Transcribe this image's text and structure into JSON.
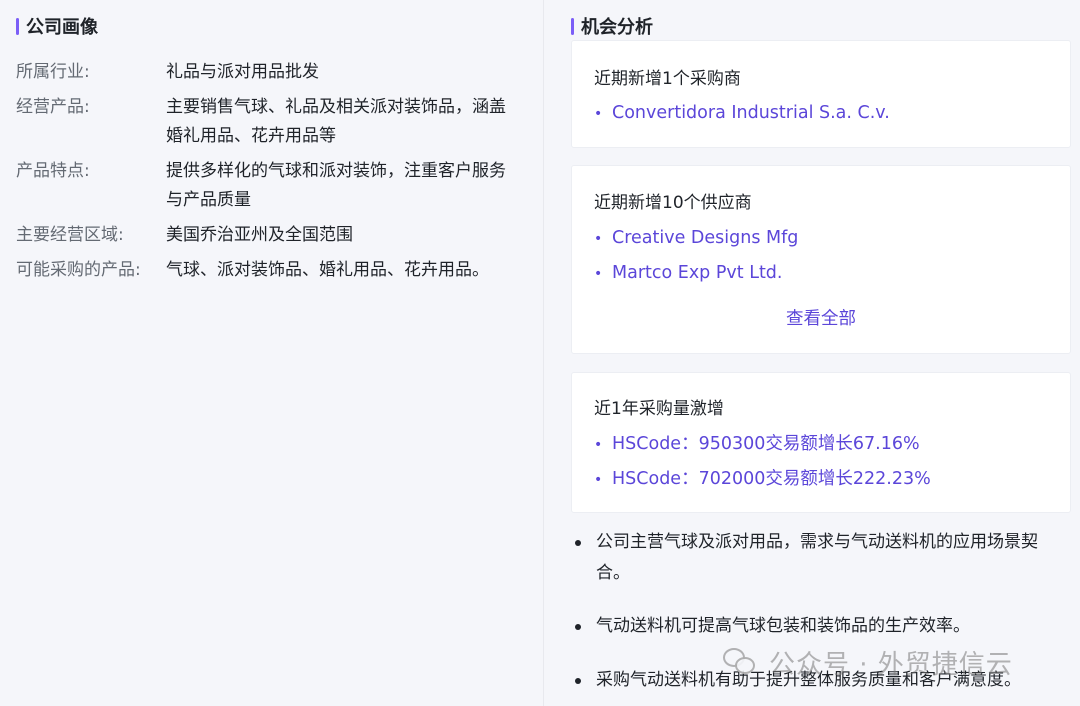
{
  "company_profile": {
    "title": "公司画像",
    "rows": [
      {
        "label": "所属行业:",
        "value": "礼品与派对用品批发"
      },
      {
        "label": "经营产品:",
        "value": "主要销售气球、礼品及相关派对装饰品，涵盖婚礼用品、花卉用品等"
      },
      {
        "label": "产品特点:",
        "value": "提供多样化的气球和派对装饰，注重客户服务与产品质量"
      },
      {
        "label": "主要经营区域:",
        "value": "美国乔治亚州及全国范围"
      },
      {
        "label": "可能采购的产品:",
        "value": "气球、派对装饰品、婚礼用品、花卉用品。"
      }
    ]
  },
  "opportunity": {
    "title": "机会分析",
    "buyers_card": {
      "title": "近期新增1个采购商",
      "items": [
        "Convertidora Industrial S.a. C.v."
      ]
    },
    "suppliers_card": {
      "title": "近期新增10个供应商",
      "items": [
        "Creative Designs Mfg",
        "Martco Exp Pvt Ltd."
      ],
      "view_all": "查看全部"
    },
    "surge_card": {
      "title": "近1年采购量激增",
      "items": [
        "HSCode：950300交易额增长67.16%",
        "HSCode：702000交易额增长222.23%"
      ]
    },
    "bullets": [
      "公司主营气球及派对用品，需求与气动送料机的应用场景契合。",
      "气动送料机可提高气球包装和装饰品的生产效率。",
      "采购气动送料机有助于提升整体服务质量和客户满意度。"
    ],
    "bullet_marker": "•"
  },
  "watermark": {
    "text": "公众号 · 外贸捷信云",
    "icon": "wechat-icon"
  },
  "colors": {
    "accent": "#7b5ef7",
    "link": "#5b46d9",
    "label": "#646a73",
    "text": "#1f2329",
    "background": "#f5f6fa",
    "card": "#ffffff"
  }
}
